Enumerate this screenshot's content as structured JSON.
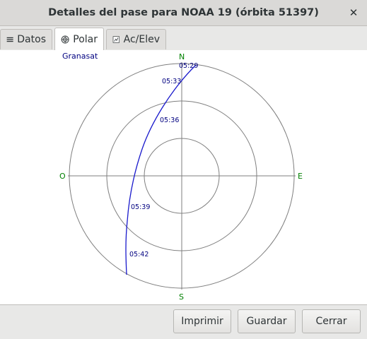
{
  "window": {
    "title": "Detalles del pase para NOAA 19 (órbita 51397)",
    "close_icon": "close-icon"
  },
  "tabs": [
    {
      "label": "Datos",
      "icon": "list-icon"
    },
    {
      "label": "Polar",
      "icon": "polar-icon",
      "active": true
    },
    {
      "label": "Ac/Elev",
      "icon": "chart-icon"
    }
  ],
  "polar": {
    "ground_station": "Granasat",
    "directions": {
      "north": "N",
      "south": "S",
      "east": "E",
      "west": "O"
    },
    "time_labels": [
      "05:29",
      "05:33",
      "05:36",
      "05:39",
      "05:42"
    ],
    "colors": {
      "track": "#1a1acc",
      "grid": "#7f7f7f",
      "direction": "#008000",
      "label": "#000080"
    }
  },
  "buttons": {
    "print": "Imprimir",
    "save": "Guardar",
    "close": "Cerrar"
  }
}
